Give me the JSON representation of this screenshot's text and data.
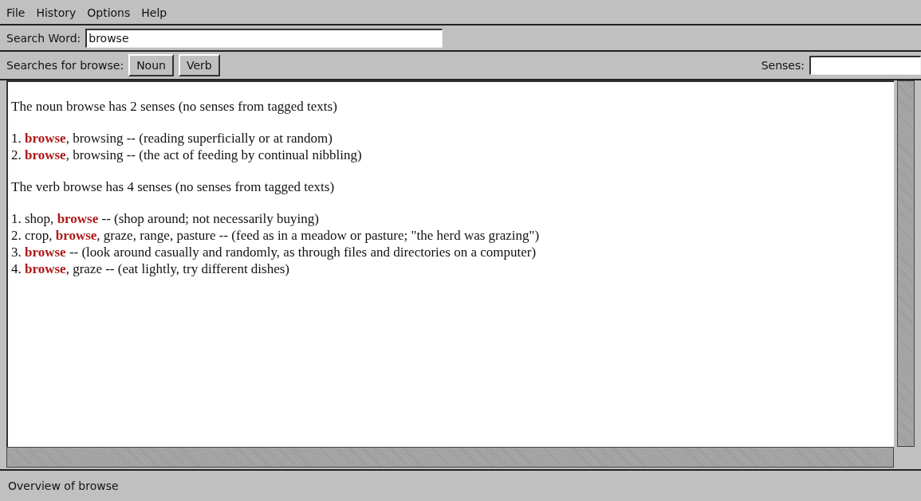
{
  "menu": [
    "File",
    "History",
    "Options",
    "Help"
  ],
  "search": {
    "label": "Search Word:",
    "value": "browse"
  },
  "searches": {
    "label": "Searches for browse:",
    "buttons": [
      "Noun",
      "Verb"
    ],
    "senses_label": "Senses:"
  },
  "content": {
    "sections": [
      {
        "summary": "The noun browse has 2 senses (no senses from tagged texts)",
        "senses": [
          "1. **browse**, browsing -- (reading superficially or at random)",
          "2. **browse**, browsing -- (the act of feeding by continual nibbling)"
        ]
      },
      {
        "summary": "The verb browse has 4 senses (no senses from tagged texts)",
        "senses": [
          "1. shop, **browse** -- (shop around; not necessarily buying)",
          "2. crop, **browse**, graze, range, pasture -- (feed as in a meadow or pasture; \"the herd was grazing\")",
          "3. **browse** -- (look around casually and randomly, as through files and directories on a computer)",
          "4. **browse**, graze -- (eat lightly, try different dishes)"
        ]
      }
    ]
  },
  "status_bar": "Overview of browse"
}
